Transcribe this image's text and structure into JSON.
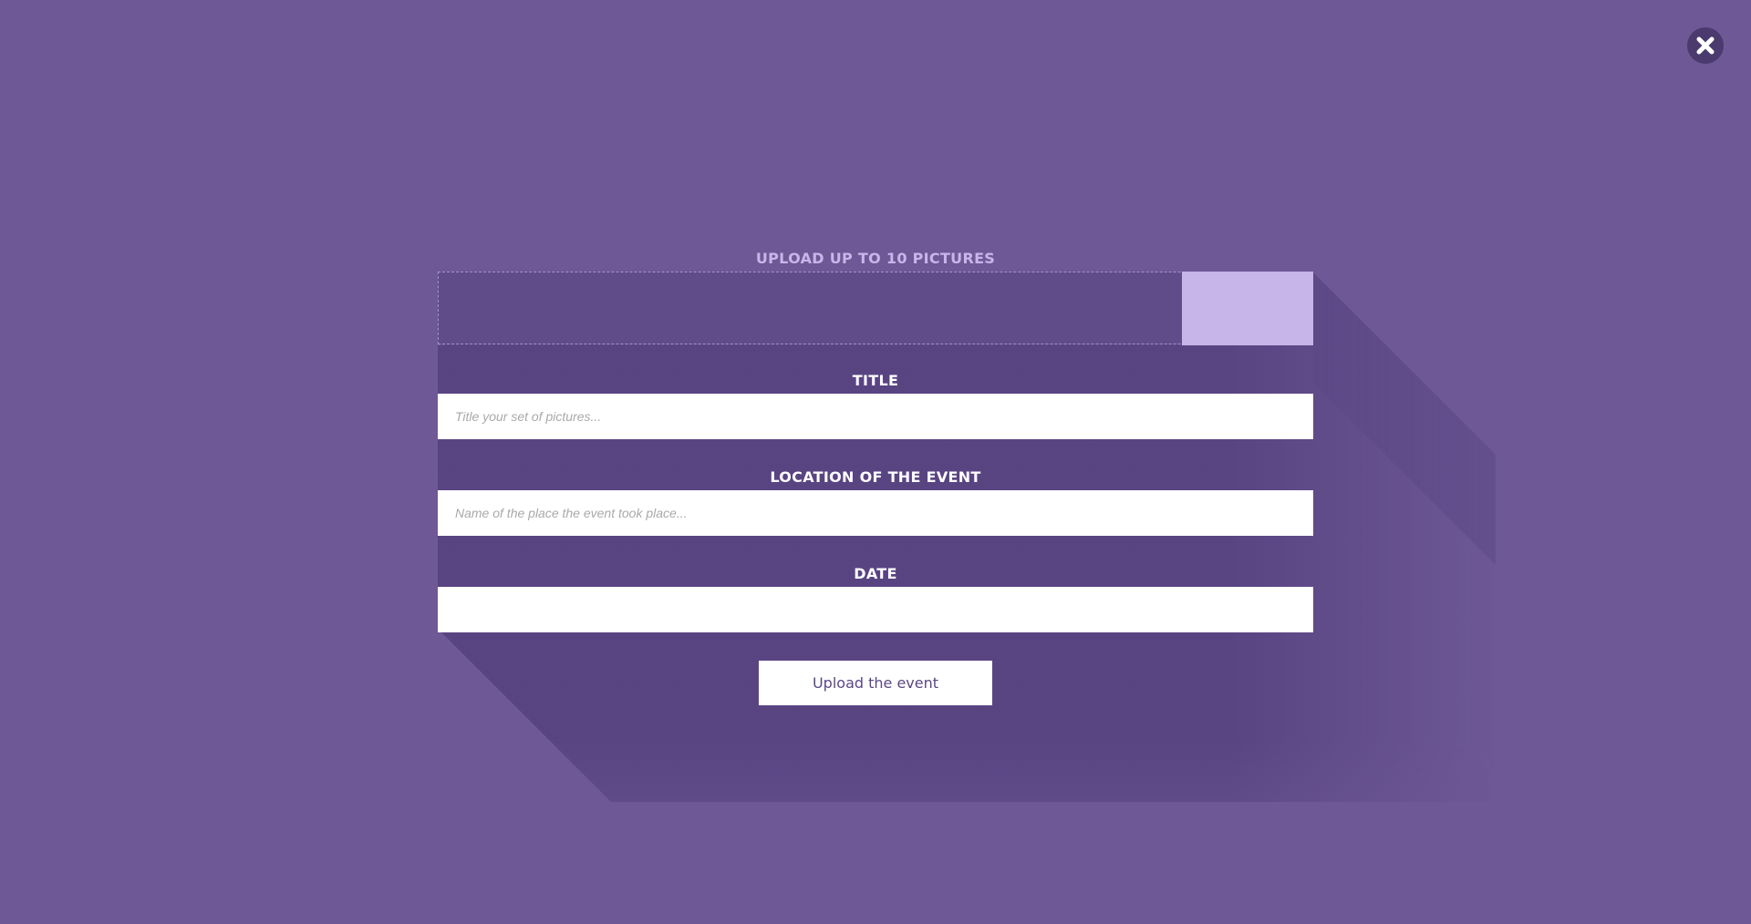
{
  "upload": {
    "label": "UPLOAD UP TO 10 PICTURES"
  },
  "fields": {
    "title": {
      "label": "TITLE",
      "placeholder": "Title your set of pictures...",
      "value": ""
    },
    "location": {
      "label": "LOCATION OF THE EVENT",
      "placeholder": "Name of the place the event took place...",
      "value": ""
    },
    "date": {
      "label": "DATE",
      "value": ""
    }
  },
  "submit": {
    "label": "Upload the event"
  },
  "colors": {
    "background": "#6e5896",
    "dropzone": "#614c8a",
    "browse_button": "#c7b4e8",
    "upload_label": "#c9b5ea",
    "shadow": "#584480"
  },
  "icons": {
    "close": "close-icon"
  }
}
